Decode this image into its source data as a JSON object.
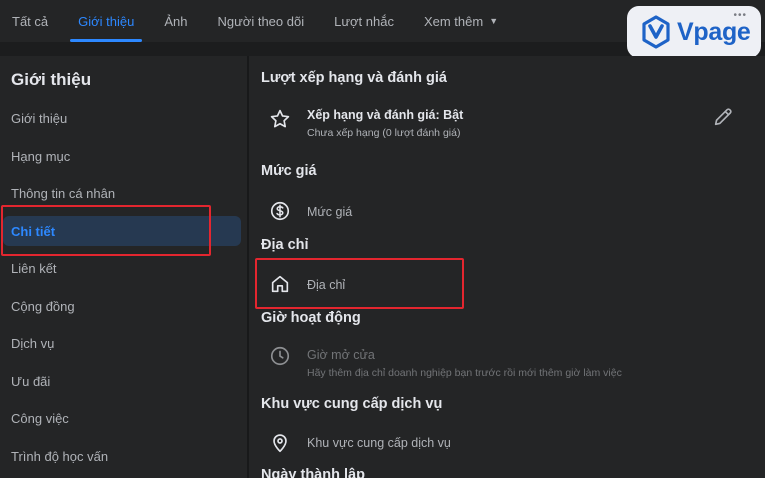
{
  "tabs": [
    {
      "label": "Tất cả"
    },
    {
      "label": "Giới thiệu"
    },
    {
      "label": "Ảnh"
    },
    {
      "label": "Người theo dõi"
    },
    {
      "label": "Lượt nhắc"
    },
    {
      "label": "Xem thêm"
    }
  ],
  "active_tab": "Giới thiệu",
  "logo": {
    "text": "Vpage",
    "dots": "•••"
  },
  "sidebar": {
    "title": "Giới thiệu",
    "items": [
      {
        "label": "Giới thiệu"
      },
      {
        "label": "Hạng mục"
      },
      {
        "label": "Thông tin cá nhân"
      },
      {
        "label": "Chi tiết"
      },
      {
        "label": "Liên kết"
      },
      {
        "label": "Cộng đồng"
      },
      {
        "label": "Dịch vụ"
      },
      {
        "label": "Ưu đãi"
      },
      {
        "label": "Công việc"
      },
      {
        "label": "Trình độ học vấn"
      }
    ],
    "selected": "Chi tiết"
  },
  "details": {
    "rating": {
      "title": "Lượt xếp hạng và đánh giá",
      "label": "Xếp hạng và đánh giá: Bật",
      "sub": "Chưa xếp hạng (0 lượt đánh giá)",
      "icon": "star-icon"
    },
    "price": {
      "title": "Mức giá",
      "label": "Mức giá",
      "icon": "dollar-circle-icon"
    },
    "address": {
      "title": "Địa chỉ",
      "label": "Địa chỉ",
      "icon": "home-icon"
    },
    "hours": {
      "title": "Giờ hoạt động",
      "label": "Giờ mở cửa",
      "sub": "Hãy thêm địa chỉ doanh nghiệp bạn trước rồi mới thêm giờ làm việc",
      "icon": "clock-icon"
    },
    "service_area": {
      "title": "Khu vực cung cấp dịch vụ",
      "label": "Khu vực cung cấp dịch vụ",
      "icon": "location-pin-icon"
    },
    "founded": {
      "title": "Ngày thành lập"
    }
  },
  "colors": {
    "accent": "#2d88ff",
    "highlight": "#e3262f",
    "panel": "#242526",
    "background": "#18191a"
  }
}
